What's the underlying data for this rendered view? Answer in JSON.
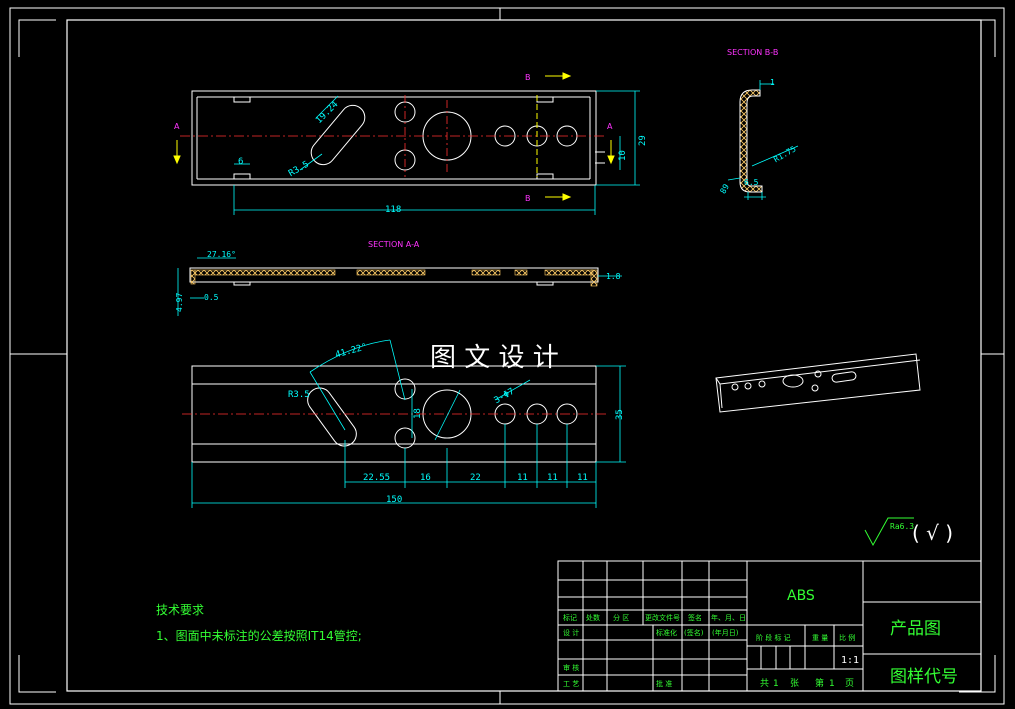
{
  "colors": {
    "background": "#000000",
    "frame": "#ffffff",
    "part_outline": "#ffffff",
    "dimension": "#00ffff",
    "center_line": "#ff3030",
    "section_label": "#ff33ff",
    "arrow": "#ffff00",
    "note": "#33ff33",
    "hatch": "#ffcc66"
  },
  "labels": {
    "section_bb": "SECTION B-B",
    "section_aa": "SECTION A-A",
    "cut_a": "A",
    "cut_b": "B",
    "watermark": "图 文 设 计"
  },
  "dimensions": {
    "top_view": {
      "slot_len": "19.24",
      "slot_r": "R3.5",
      "offset": "6",
      "length": "118",
      "height": "29",
      "hole_offset": "10"
    },
    "section_bb": {
      "thk": "1",
      "bend_r": "R1.75",
      "flange": "6.5",
      "angle": "89"
    },
    "section_aa": {
      "angle": "27.16°",
      "thk": "1.8",
      "height": "4.97",
      "gap": "0.5"
    },
    "bottom_view": {
      "angle": "41.22°",
      "slot_r": "R3.5",
      "hole_dia": "3-Φ7",
      "spacing": "18",
      "height": "35",
      "chain": [
        "22.55",
        "16",
        "22",
        "11",
        "11",
        "11"
      ],
      "length": "150"
    }
  },
  "roughness": {
    "value": "Ra6.3",
    "mark": "( √ )"
  },
  "notes": {
    "title": "技术要求",
    "item1": "1、图面中未标注的公差按照IT14管控;"
  },
  "title_block": {
    "material": "ABS",
    "drawing_name": "产品图",
    "drawing_code": "图样代号",
    "scale": "1:1",
    "header_row": [
      "标记",
      "处数",
      "分  区",
      "更改文件号",
      "签名",
      "年、月、日"
    ],
    "row_design": [
      "设  计",
      "标准化",
      "(签名)",
      "(年月日)"
    ],
    "stage_row": [
      "阶  段  标  记",
      "重  量",
      "比  例"
    ],
    "row_review": "审  核",
    "row_process": "工  艺",
    "row_approve": "批  准",
    "sheets": [
      "共",
      "1",
      "张",
      "第",
      "1",
      "页"
    ]
  }
}
